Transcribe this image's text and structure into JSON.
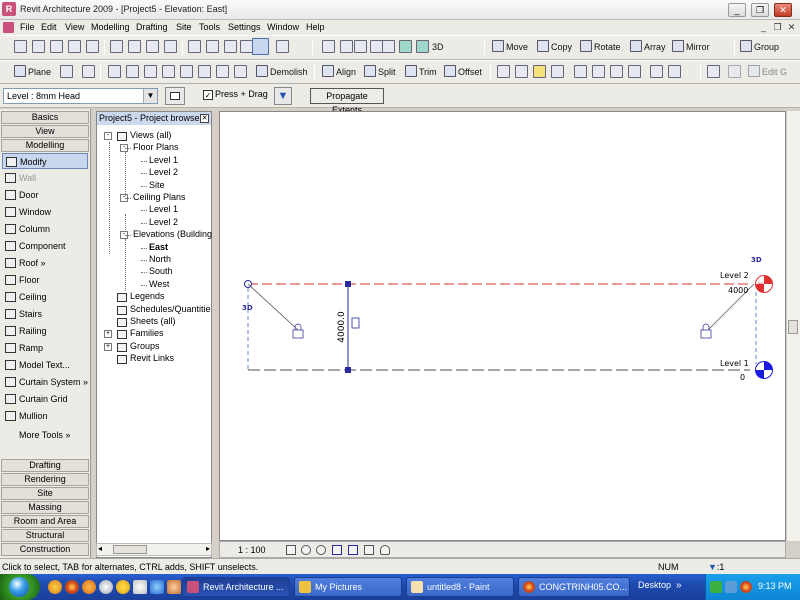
{
  "window": {
    "title": "Revit Architecture 2009 - [Project5 - Elevation: East]",
    "logo_text": "R"
  },
  "menu": {
    "items": [
      "File",
      "Edit",
      "View",
      "Modelling",
      "Drafting",
      "Site",
      "Tools",
      "Settings",
      "Window",
      "Help"
    ]
  },
  "toolbar1": {
    "view3d_label": "3D",
    "move_label": "Move",
    "copy_label": "Copy",
    "rotate_label": "Rotate",
    "array_label": "Array",
    "mirror_label": "Mirror",
    "group_label": "Group"
  },
  "toolbar2": {
    "plane_label": "Plane",
    "demolish_label": "Demolish",
    "align_label": "Align",
    "split_label": "Split",
    "trim_label": "Trim",
    "offset_label": "Offset",
    "editgroup_label": "Edit G"
  },
  "options": {
    "level_select": "Level : 8mm Head",
    "press_drag_label": "Press + Drag",
    "press_drag_checked": true,
    "propagate_label": "Propagate Extents"
  },
  "designbar": {
    "top_tabs": [
      "Basics",
      "View",
      "Modelling"
    ],
    "tools": [
      {
        "label": "Modify",
        "icon": "arrow-cursor-icon",
        "state": "selected"
      },
      {
        "label": "Wall",
        "icon": "wall-icon",
        "state": "disabled"
      },
      {
        "label": "Door",
        "icon": "door-icon",
        "state": ""
      },
      {
        "label": "Window",
        "icon": "window-icon",
        "state": ""
      },
      {
        "label": "Column",
        "icon": "column-icon",
        "state": ""
      },
      {
        "label": "Component",
        "icon": "component-icon",
        "state": ""
      },
      {
        "label": "Roof »",
        "icon": "roof-icon",
        "state": ""
      },
      {
        "label": "Floor",
        "icon": "floor-icon",
        "state": ""
      },
      {
        "label": "Ceiling",
        "icon": "ceiling-icon",
        "state": ""
      },
      {
        "label": "Stairs",
        "icon": "stairs-icon",
        "state": ""
      },
      {
        "label": "Railing",
        "icon": "railing-icon",
        "state": ""
      },
      {
        "label": "Ramp",
        "icon": "ramp-icon",
        "state": ""
      },
      {
        "label": "Model Text...",
        "icon": "model-text-icon",
        "state": ""
      },
      {
        "label": "Curtain System »",
        "icon": "curtain-system-icon",
        "state": ""
      },
      {
        "label": "Curtain Grid",
        "icon": "curtain-grid-icon",
        "state": ""
      },
      {
        "label": "Mullion",
        "icon": "mullion-icon",
        "state": ""
      }
    ],
    "more_tools_label": "More Tools »",
    "bottom_tabs": [
      "Drafting",
      "Rendering",
      "Site",
      "Massing",
      "Room and Area",
      "Structural",
      "Construction"
    ]
  },
  "browser": {
    "title": "Project5 - Project browser",
    "nodes": [
      {
        "label": "Views (all)",
        "depth": 0,
        "expander": "-",
        "bold": false
      },
      {
        "label": "Floor Plans",
        "depth": 1,
        "expander": "-",
        "bold": false
      },
      {
        "label": "Level 1",
        "depth": 2,
        "expander": "",
        "bold": false
      },
      {
        "label": "Level 2",
        "depth": 2,
        "expander": "",
        "bold": false
      },
      {
        "label": "Site",
        "depth": 2,
        "expander": "",
        "bold": false
      },
      {
        "label": "Ceiling Plans",
        "depth": 1,
        "expander": "-",
        "bold": false
      },
      {
        "label": "Level 1",
        "depth": 2,
        "expander": "",
        "bold": false
      },
      {
        "label": "Level 2",
        "depth": 2,
        "expander": "",
        "bold": false
      },
      {
        "label": "Elevations (Building",
        "depth": 1,
        "expander": "-",
        "bold": false
      },
      {
        "label": "East",
        "depth": 2,
        "expander": "",
        "bold": true
      },
      {
        "label": "North",
        "depth": 2,
        "expander": "",
        "bold": false
      },
      {
        "label": "South",
        "depth": 2,
        "expander": "",
        "bold": false
      },
      {
        "label": "West",
        "depth": 2,
        "expander": "",
        "bold": false
      },
      {
        "label": "Legends",
        "depth": 0,
        "expander": "",
        "bold": false
      },
      {
        "label": "Schedules/Quantitie",
        "depth": 0,
        "expander": "",
        "bold": false
      },
      {
        "label": "Sheets (all)",
        "depth": 0,
        "expander": "",
        "bold": false
      },
      {
        "label": "Families",
        "depth": 0,
        "expander": "+",
        "bold": false
      },
      {
        "label": "Groups",
        "depth": 0,
        "expander": "+",
        "bold": false
      },
      {
        "label": "Revit Links",
        "depth": 0,
        "expander": "",
        "bold": false
      }
    ]
  },
  "drawing": {
    "level2_name": "Level 2",
    "level2_value": "4000",
    "level1_name": "Level 1",
    "level1_value": "0",
    "dimension_text": "4000.0",
    "tag_3d_left": "3D",
    "tag_3d_right": "3D",
    "level2_color": "#e03030",
    "level1_color": "#707070",
    "head_color": "#1a1ae0"
  },
  "viewbar": {
    "scale": "1 : 100"
  },
  "status": {
    "text": "Click to select, TAB for alternates, CTRL adds, SHIFT unselects.",
    "num": "NUM",
    "filter_count": ":1"
  },
  "taskbar": {
    "tasks": [
      {
        "label": "Revit Architecture ...",
        "active": true
      },
      {
        "label": "My Pictures",
        "active": false
      },
      {
        "label": "untitled8 - Paint",
        "active": false
      },
      {
        "label": "CONGTRINH05.CO...",
        "active": false
      }
    ],
    "desktop_label": "Desktop",
    "clock": "9:13 PM"
  }
}
